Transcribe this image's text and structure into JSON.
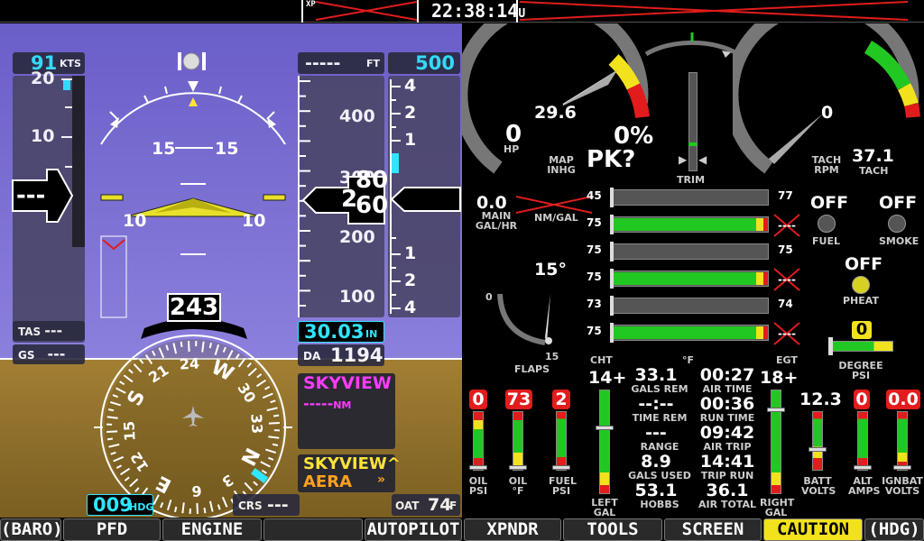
{
  "status_bar": {
    "xp_label": "XP",
    "clock": "22:38:14",
    "clock_suffix": "U"
  },
  "pfd": {
    "airspeed": "91",
    "airspeed_unit": "KTS",
    "speed_tape": [
      "20",
      "10"
    ],
    "speed_readout": "---",
    "altitude_bug": "-----",
    "altitude_bug_unit": "FT",
    "vs_bug": "500",
    "alt_tape": [
      "400",
      "300",
      "200",
      "100"
    ],
    "alt_readout_big": "2",
    "alt_readout_roll_top": "80",
    "alt_readout_roll_bottom": "60",
    "vsi_scale": [
      "4",
      "2",
      "1",
      "1",
      "2",
      "4"
    ],
    "pitch_marks": [
      "15",
      "15",
      "10",
      "10"
    ],
    "tas_label": "TAS",
    "tas_value": "---",
    "gs_label": "GS",
    "gs_value": "---",
    "baro": "30.03",
    "baro_unit": "IN",
    "da_label": "DA",
    "da_value": "1194",
    "heading": "243",
    "compass_labels": [
      "N",
      "3",
      "6",
      "E",
      "12",
      "15",
      "S",
      "21",
      "24",
      "W",
      "30",
      "33"
    ],
    "hdg_bug": "009",
    "hdg_bug_unit": "HDG",
    "crs_label": "CRS",
    "crs_value": "---",
    "oat_label": "OAT",
    "oat_value": "74",
    "oat_unit": "F",
    "nav_source": "SKYVIEW",
    "nav_dist": "-----",
    "nav_dist_unit": "NM",
    "gps_source_1": "SKYVIEW^",
    "gps_source_2": "AERA"
  },
  "engine": {
    "map_value": "29.6",
    "map_label_1": "MAP",
    "map_label_2": "INHG",
    "hp_value": "0",
    "hp_label": "HP",
    "power_pct": "0%",
    "power_mode": "PK?",
    "trim_label": "TRIM",
    "tach_value": "0",
    "tach_label_1": "TACH",
    "tach_label_2": "RPM",
    "tach_hours": "37.1",
    "tach_hours_label": "TACH",
    "fuel_flow": "0.0",
    "fuel_flow_label_1": "MAIN",
    "fuel_flow_label_2": "GAL/HR",
    "nm_gal_label": "NM/GAL",
    "cht_values": [
      "45",
      "75",
      "75",
      "75",
      "73",
      "75"
    ],
    "egt_values": [
      "77",
      "75",
      "74"
    ],
    "cht_label": "CHT",
    "deg_label": "°F",
    "egt_label": "EGT",
    "flaps_angle": "15°",
    "flaps_min": "0",
    "flaps_max": "15",
    "flaps_label": "FLAPS",
    "fuel_pump_state": "OFF",
    "fuel_pump_label": "FUEL",
    "smoke_state": "OFF",
    "smoke_label": "SMOKE",
    "pheat_state": "OFF",
    "pheat_label": "PHEAT",
    "degree_psi_value": "0",
    "degree_psi_label_1": "DEGREE",
    "degree_psi_label_2": "PSI",
    "oil_psi": "0",
    "oil_psi_label_1": "OIL",
    "oil_psi_label_2": "PSI",
    "oil_temp": "73",
    "oil_temp_label_1": "OIL",
    "oil_temp_label_2": "°F",
    "fuel_psi": "2",
    "fuel_psi_label_1": "FUEL",
    "fuel_psi_label_2": "PSI",
    "left_gal": "14+",
    "left_gal_label_1": "LEFT",
    "left_gal_label_2": "GAL",
    "right_gal": "18+",
    "right_gal_label_1": "RIGHT",
    "right_gal_label_2": "GAL",
    "batt_volts": "12.3",
    "batt_label_1": "BATT",
    "batt_label_2": "VOLTS",
    "alt_amps": "0",
    "alt_amps_label_1": "ALT",
    "alt_amps_label_2": "AMPS",
    "ignbat_volts": "0.0",
    "ignbat_label_1": "IGNBAT",
    "ignbat_label_2": "VOLTS",
    "timers": [
      {
        "v1": "33.1",
        "v2": "00:27",
        "l1": "GALS REM",
        "l2": "AIR TIME"
      },
      {
        "v1": "--:--",
        "v2": "00:36",
        "l1": "TIME REM",
        "l2": "RUN TIME"
      },
      {
        "v1": "---",
        "v2": "09:42",
        "l1": "RANGE",
        "l2": "AIR TRIP"
      },
      {
        "v1": "8.9",
        "v2": "14:41",
        "l1": "GALS USED",
        "l2": "TRIP RUN"
      },
      {
        "v1": "53.1",
        "v2": "36.1",
        "l1": "HOBBS",
        "l2": "AIR TOTAL"
      }
    ]
  },
  "buttons": [
    "(BARO)",
    "PFD",
    "ENGINE",
    "",
    "AUTOPILOT",
    "XPNDR",
    "TOOLS",
    "SCREEN",
    "CAUTION",
    "(HDG)"
  ],
  "colors": {
    "sky": "#7b6fd0",
    "ground": "#9a7a32",
    "cyan": "#2ee6ff",
    "magenta": "#ff3cff",
    "green": "#22c822",
    "yellow": "#f2e21e",
    "red": "#e21c1c"
  }
}
